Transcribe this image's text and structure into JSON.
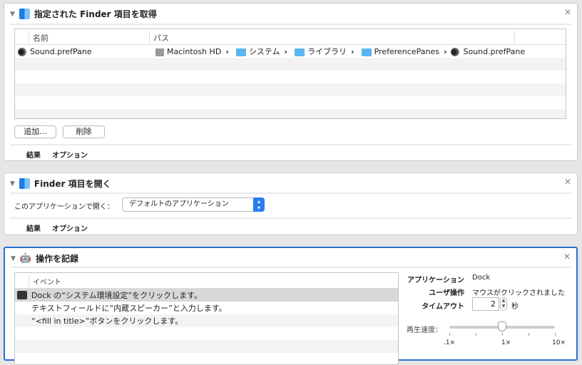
{
  "panel1": {
    "title": "指定された Finder 項目を取得",
    "col_name": "名前",
    "col_path": "パス",
    "row": {
      "name": "Sound.prefPane",
      "path": [
        "Macintosh HD",
        "システム",
        "ライブラリ",
        "PreferencePanes",
        "Sound.prefPane"
      ]
    },
    "add": "追加...",
    "remove": "削除",
    "tabs": [
      "結果",
      "オプション"
    ]
  },
  "panel2": {
    "title": "Finder 項目を開く",
    "open_with_label": "このアプリケーションで開く：",
    "open_with_value": "デフォルトのアプリケーション",
    "tabs": [
      "結果",
      "オプション"
    ]
  },
  "panel3": {
    "title": "操作を記録",
    "col_event": "イベント",
    "events": [
      "Dock の“システム環境設定”をクリックします。",
      "テキストフィールドに“内蔵スピーカー”と入力します。",
      "“<fill in title>”ボタンをクリックします。"
    ],
    "app_label": "アプリケーション",
    "app_value": "Dock",
    "action_label": "ユーザ操作",
    "action_value": "マウスがクリックされました",
    "timeout_label": "タイムアウト",
    "timeout_value": "2",
    "timeout_unit": "秒",
    "speed_label": "再生速度：",
    "speed_ticks": [
      ".1×",
      "1×",
      "10×"
    ],
    "speed_value_fraction": 0.5
  },
  "colors": {
    "accent": "#2a6fd6"
  }
}
